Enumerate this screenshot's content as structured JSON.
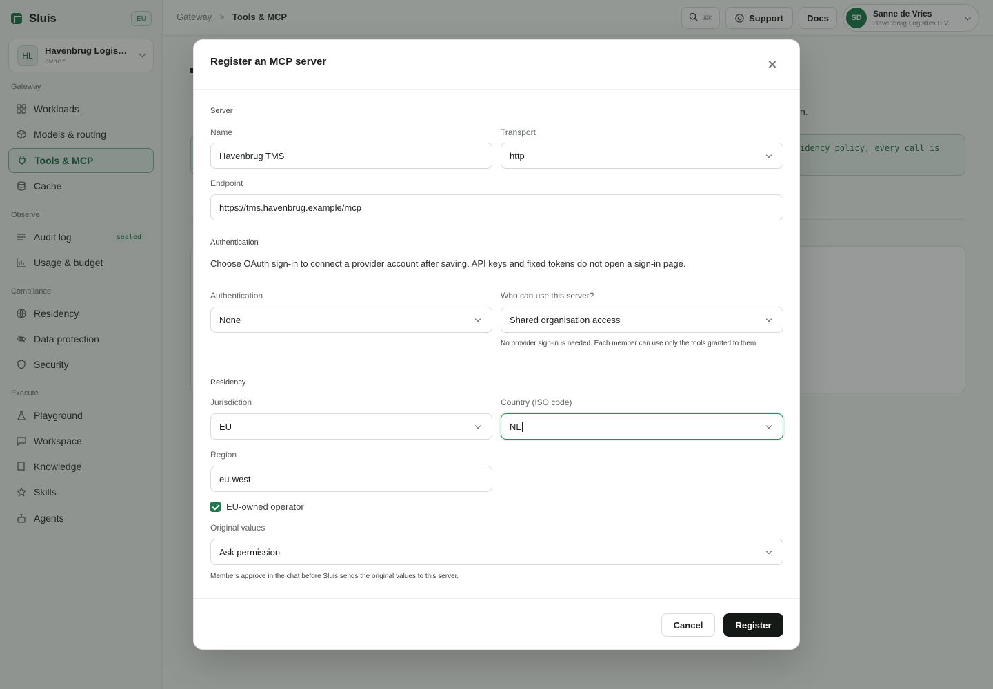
{
  "brand": {
    "name": "Sluis",
    "region_badge": "EU"
  },
  "org": {
    "initials": "HL",
    "name": "Havenbrug Logis…",
    "role": "owner"
  },
  "sidebar": {
    "sections": {
      "gateway": "Gateway",
      "observe": "Observe",
      "compliance": "Compliance",
      "execute": "Execute"
    },
    "items": {
      "workloads": "Workloads",
      "models": "Models & routing",
      "tools": "Tools & MCP",
      "cache": "Cache",
      "audit": "Audit log",
      "audit_tag": "sealed",
      "usage": "Usage & budget",
      "residency": "Residency",
      "data_protection": "Data protection",
      "security": "Security",
      "playground": "Playground",
      "workspace": "Workspace",
      "knowledge": "Knowledge",
      "skills": "Skills",
      "agents": "Agents"
    }
  },
  "topbar": {
    "breadcrumb_root": "Gateway",
    "breadcrumb_sep": ">",
    "breadcrumb_current": "Tools & MCP",
    "search_shortcut": "⌘K",
    "support_label": "Support",
    "docs_label": "Docs",
    "user_initials": "SD",
    "user_name": "Sanne de Vries",
    "user_org": "Havenbrug Logistics B.V."
  },
  "background": {
    "visible_text": "n.",
    "policy_text": "idency policy, every call is"
  },
  "modal": {
    "title": "Register an MCP server",
    "server": {
      "section": "Server",
      "name_label": "Name",
      "name_value": "Havenbrug TMS",
      "transport_label": "Transport",
      "transport_value": "http",
      "endpoint_label": "Endpoint",
      "endpoint_value": "https://tms.havenbrug.example/mcp"
    },
    "auth": {
      "section": "Authentication",
      "description": "Choose OAuth sign-in to connect a provider account after saving. API keys and fixed tokens do not open a sign-in page.",
      "auth_label": "Authentication",
      "auth_value": "None",
      "access_label": "Who can use this server?",
      "access_value": "Shared organisation access",
      "access_help": "No provider sign-in is needed. Each member can use only the tools granted to them."
    },
    "residency": {
      "section": "Residency",
      "jurisdiction_label": "Jurisdiction",
      "jurisdiction_value": "EU",
      "country_label": "Country (ISO code)",
      "country_value": "NL",
      "region_label": "Region",
      "region_value": "eu-west",
      "eu_owned_label": "EU-owned operator",
      "eu_owned_checked": true,
      "original_label": "Original values",
      "original_value": "Ask permission",
      "original_help": "Members approve in the chat before Sluis sends the original values to this server."
    },
    "footer": {
      "cancel_label": "Cancel",
      "register_label": "Register"
    }
  },
  "colors": {
    "accent": "#1c7a4c",
    "primary_button": "#151a17",
    "overlay": "#18201b"
  }
}
